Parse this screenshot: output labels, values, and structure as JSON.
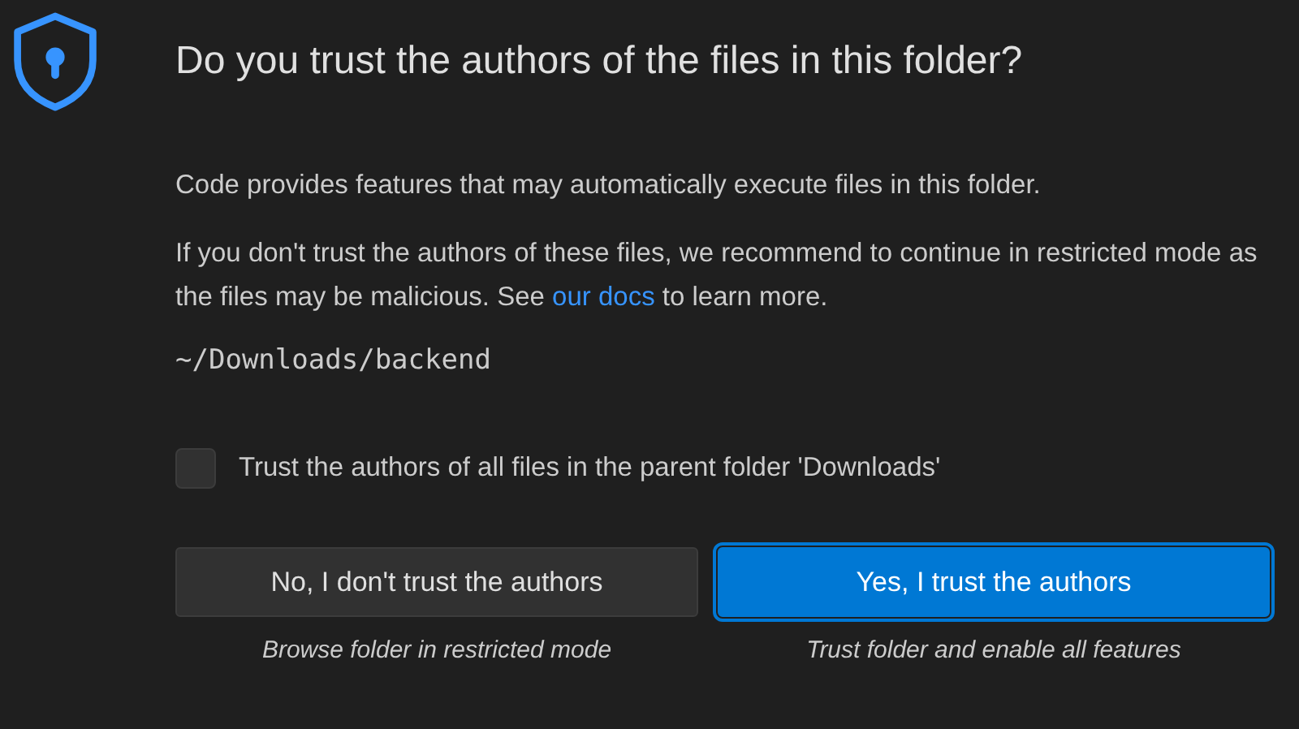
{
  "dialog": {
    "title": "Do you trust the authors of the files in this folder?",
    "message": "Code provides features that may automatically execute files in this folder.",
    "warning": {
      "before": "If you don't trust the authors of these files, we recommend to continue in restricted mode as the files may be malicious. See ",
      "link": "our docs",
      "after": " to learn more."
    },
    "path": "~/Downloads/backend",
    "checkbox": {
      "label": "Trust the authors of all files in the parent folder 'Downloads'",
      "checked": false
    },
    "buttons": [
      {
        "kind": "secondary",
        "label": "No, I don't trust the authors",
        "caption": "Browse folder in restricted mode"
      },
      {
        "kind": "primary",
        "label": "Yes, I trust the authors",
        "caption": "Trust folder and enable all features"
      }
    ]
  }
}
